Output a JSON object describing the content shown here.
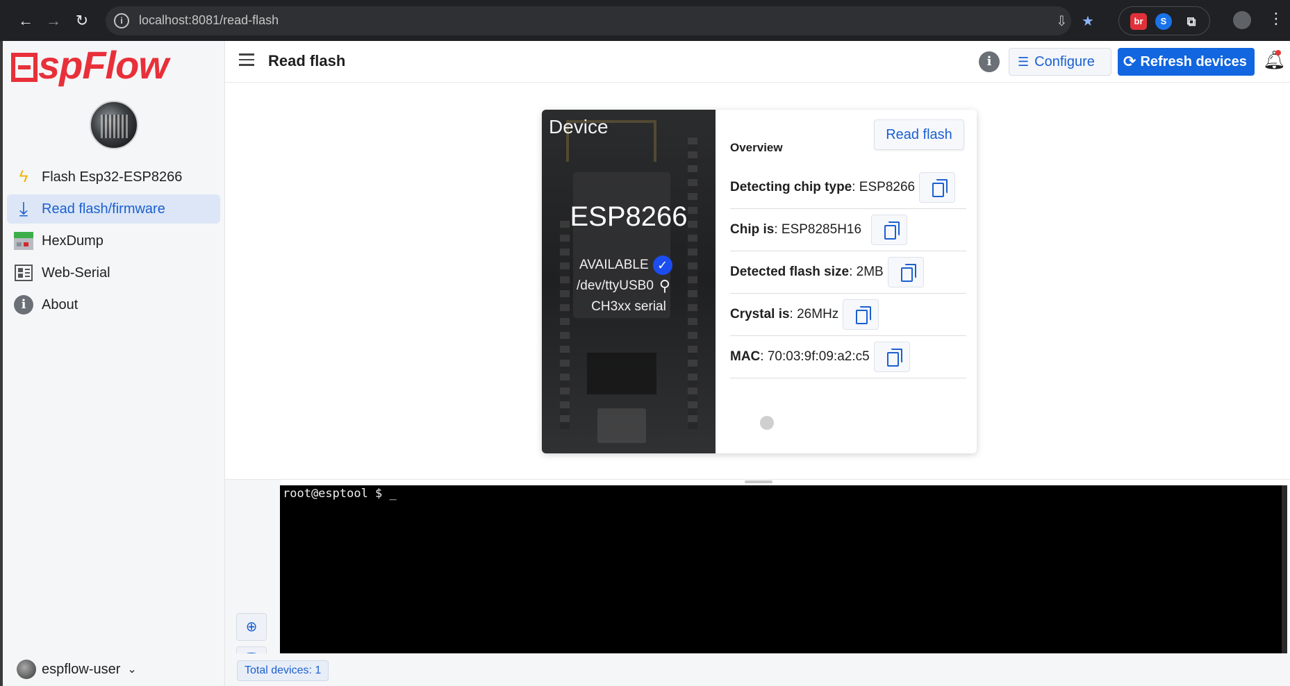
{
  "browser": {
    "url": "localhost:8081/read-flash",
    "extensions": [
      "br",
      "S"
    ]
  },
  "sidebar": {
    "logo_text": "spFlow",
    "items": [
      {
        "label": "Flash Esp32-ESP8266",
        "icon": "lightning-icon"
      },
      {
        "label": "Read flash/firmware",
        "icon": "download-icon",
        "active": true
      },
      {
        "label": "HexDump",
        "icon": "hexdump-grid-icon"
      },
      {
        "label": "Web-Serial",
        "icon": "serial-panel-icon"
      },
      {
        "label": "About",
        "icon": "info-icon"
      }
    ],
    "user": "espflow-user"
  },
  "header": {
    "title": "Read flash",
    "configure_label": "Configure",
    "refresh_label": "Refresh devices"
  },
  "device_card": {
    "device_label": "Device",
    "chip": "ESP8266",
    "status": "AVAILABLE",
    "port": "/dev/ttyUSB0",
    "serial": "CH3xx serial",
    "read_flash_label": "Read flash",
    "overview_label": "Overview",
    "rows": [
      {
        "label": "Detecting chip type",
        "value": ": ESP8266"
      },
      {
        "label": "Chip is",
        "value": ": ESP8285H16"
      },
      {
        "label": "Detected flash size",
        "value": ": 2MB"
      },
      {
        "label": "Crystal is",
        "value": ": 26MHz"
      },
      {
        "label": "MAC",
        "value": ": 70:03:9f:09:a2:c5"
      }
    ]
  },
  "terminal": {
    "prompt": "root@esptool $ _"
  },
  "status": {
    "total_devices": "Total devices: 1"
  },
  "colors": {
    "accent": "#1266e0",
    "logo": "#e8303a",
    "active_bg": "#dce6f6"
  }
}
